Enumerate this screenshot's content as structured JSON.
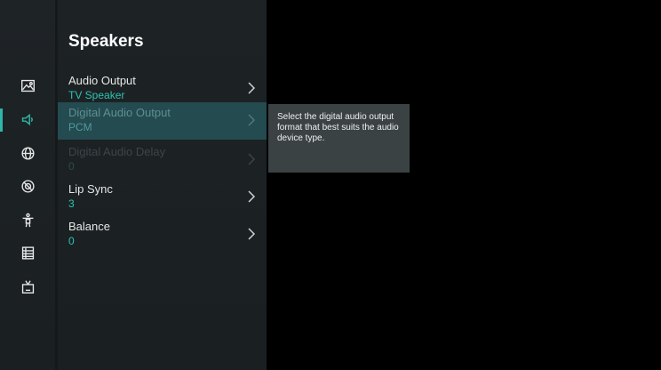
{
  "panel": {
    "title": "Speakers"
  },
  "sidebar": {
    "items": [
      {
        "icon": "picture-icon",
        "active": false
      },
      {
        "icon": "sound-icon",
        "active": true
      },
      {
        "icon": "network-icon",
        "active": false
      },
      {
        "icon": "general-icon",
        "active": false
      },
      {
        "icon": "accessibility-icon",
        "active": false
      },
      {
        "icon": "guide-icon",
        "active": false
      },
      {
        "icon": "tv-icon",
        "active": false
      }
    ]
  },
  "menu": {
    "items": [
      {
        "label": "Audio Output",
        "value": "TV Speaker",
        "state": "normal"
      },
      {
        "label": "Digital Audio Output",
        "value": "PCM",
        "state": "selected"
      },
      {
        "label": "Digital Audio Delay",
        "value": "0",
        "state": "disabled"
      },
      {
        "label": "Lip Sync",
        "value": "3",
        "state": "normal"
      },
      {
        "label": "Balance",
        "value": "0",
        "state": "normal"
      }
    ]
  },
  "tooltip": {
    "text": "Select the digital audio output format that best suits the audio device type."
  },
  "colors": {
    "accent": "#2fb6a8",
    "value_text": "#2cc3b2",
    "selected_bg": "#244b50",
    "tooltip_bg": "#3a4243"
  }
}
